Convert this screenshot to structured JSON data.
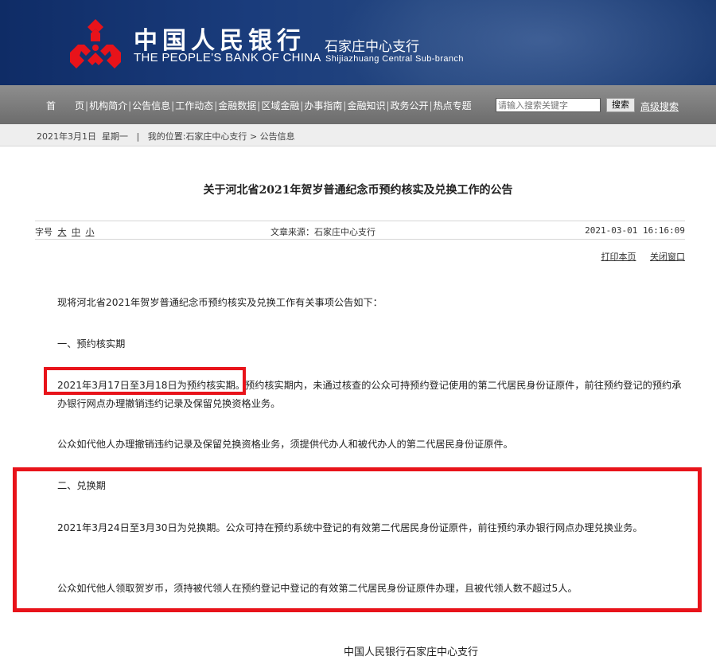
{
  "header": {
    "bank_name_cn": "中国人民银行",
    "bank_name_en": "THE PEOPLE'S BANK OF CHINA",
    "branch_cn": "石家庄中心支行",
    "branch_en": "Shijiazhuang Central Sub-branch",
    "logo_icon": "pboc-logo-icon",
    "bg_color": "#1a3c7c",
    "logo_color": "#e8131a"
  },
  "nav": {
    "items": [
      "首　　页",
      "机构简介",
      "公告信息",
      "工作动态",
      "金融数据",
      "区域金融",
      "办事指南",
      "金融知识",
      "政务公开",
      "热点专题"
    ],
    "search_placeholder": "请输入搜索关键字",
    "search_button": "搜索",
    "advanced_search": "高级搜索"
  },
  "breadcrumb": {
    "date": "2021年3月1日",
    "weekday": "星期一",
    "sep": "|",
    "location_label": "我的位置:",
    "path": [
      "石家庄中心支行",
      "公告信息"
    ],
    "arrow": ">"
  },
  "article": {
    "title": "关于河北省2021年贺岁普通纪念币预约核实及兑换工作的公告",
    "font_size_label": "字号",
    "font_sizes": [
      "大",
      "中",
      "小"
    ],
    "source": "文章来源：石家庄中心支行",
    "date": "2021-03-01 16:16:09",
    "print": "打印本页",
    "close": "关闭窗口",
    "intro": "现将河北省2021年贺岁普通纪念币预约核实及兑换工作有关事项公告如下：",
    "s1_heading": "一、预约核实期",
    "s1_p1_highlight": "2021年3月17日至3月18日为预约核实期",
    "s1_p1_rest": "。预约核实期内，未通过核查的公众可持预约登记使用的第二代居民身份证原件，前往预约登记的预约承办银行网点办理撤销违约记录及保留兑换资格业务。",
    "s1_p2": "公众如代他人办理撤销违约记录及保留兑换资格业务，须提供代办人和被代办人的第二代居民身份证原件。",
    "s2_heading": "二、兑换期",
    "s2_p1": "2021年3月24日至3月30日为兑换期。公众可持在预约系统中登记的有效第二代居民身份证原件，前往预约承办银行网点办理兑换业务。",
    "s2_p2": "公众如代他人领取贺岁币，须持被代领人在预约登记中登记的有效第二代居民身份证原件办理，且被代领人数不超过5人。",
    "signature": "中国人民银行石家庄中心支行",
    "highlight_color": "#e8131a"
  }
}
